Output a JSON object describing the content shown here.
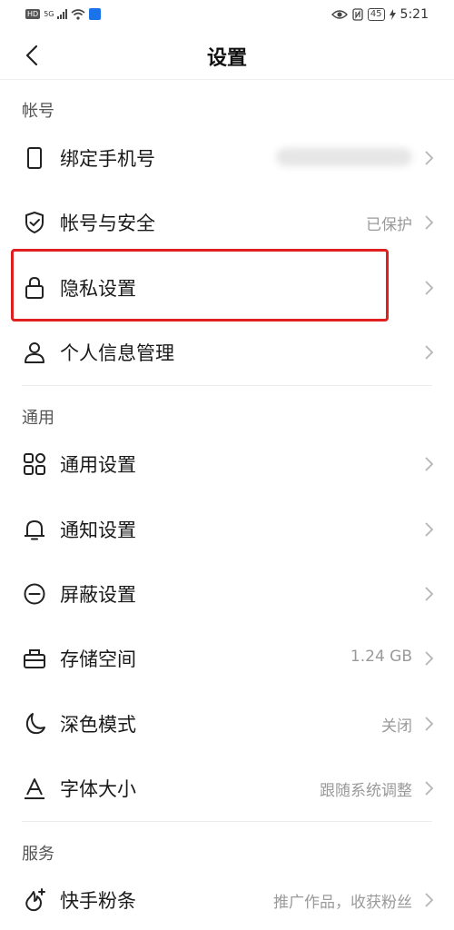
{
  "status_bar": {
    "hd": "HD",
    "network": "5G",
    "battery": "45",
    "time": "5:21"
  },
  "header": {
    "title": "设置"
  },
  "sections": {
    "account": "帐号",
    "general": "通用",
    "service": "服务"
  },
  "rows": {
    "bind_phone": {
      "label": "绑定手机号"
    },
    "account_security": {
      "label": "帐号与安全",
      "value": "已保护"
    },
    "privacy": {
      "label": "隐私设置"
    },
    "personal_info": {
      "label": "个人信息管理"
    },
    "general_settings": {
      "label": "通用设置"
    },
    "notification": {
      "label": "通知设置"
    },
    "block": {
      "label": "屏蔽设置"
    },
    "storage": {
      "label": "存储空间",
      "value": "1.24 GB"
    },
    "dark_mode": {
      "label": "深色模式",
      "value": "关闭"
    },
    "font_size": {
      "label": "字体大小",
      "value": "跟随系统调整"
    },
    "kuaishou_fan": {
      "label": "快手粉条",
      "value": "推广作品，收获粉丝"
    }
  },
  "colors": {
    "highlight": "#e02020"
  }
}
